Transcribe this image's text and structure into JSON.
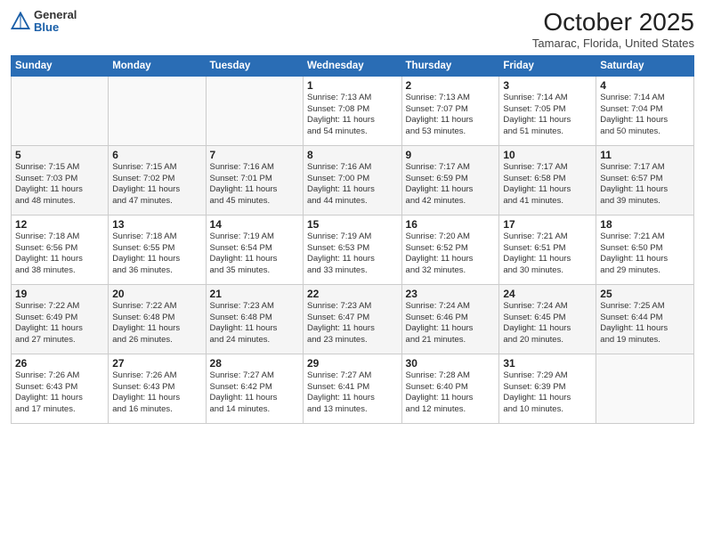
{
  "header": {
    "logo_general": "General",
    "logo_blue": "Blue",
    "month_title": "October 2025",
    "location": "Tamarac, Florida, United States"
  },
  "weekdays": [
    "Sunday",
    "Monday",
    "Tuesday",
    "Wednesday",
    "Thursday",
    "Friday",
    "Saturday"
  ],
  "weeks": [
    [
      {
        "day": "",
        "info": ""
      },
      {
        "day": "",
        "info": ""
      },
      {
        "day": "",
        "info": ""
      },
      {
        "day": "1",
        "info": "Sunrise: 7:13 AM\nSunset: 7:08 PM\nDaylight: 11 hours\nand 54 minutes."
      },
      {
        "day": "2",
        "info": "Sunrise: 7:13 AM\nSunset: 7:07 PM\nDaylight: 11 hours\nand 53 minutes."
      },
      {
        "day": "3",
        "info": "Sunrise: 7:14 AM\nSunset: 7:05 PM\nDaylight: 11 hours\nand 51 minutes."
      },
      {
        "day": "4",
        "info": "Sunrise: 7:14 AM\nSunset: 7:04 PM\nDaylight: 11 hours\nand 50 minutes."
      }
    ],
    [
      {
        "day": "5",
        "info": "Sunrise: 7:15 AM\nSunset: 7:03 PM\nDaylight: 11 hours\nand 48 minutes."
      },
      {
        "day": "6",
        "info": "Sunrise: 7:15 AM\nSunset: 7:02 PM\nDaylight: 11 hours\nand 47 minutes."
      },
      {
        "day": "7",
        "info": "Sunrise: 7:16 AM\nSunset: 7:01 PM\nDaylight: 11 hours\nand 45 minutes."
      },
      {
        "day": "8",
        "info": "Sunrise: 7:16 AM\nSunset: 7:00 PM\nDaylight: 11 hours\nand 44 minutes."
      },
      {
        "day": "9",
        "info": "Sunrise: 7:17 AM\nSunset: 6:59 PM\nDaylight: 11 hours\nand 42 minutes."
      },
      {
        "day": "10",
        "info": "Sunrise: 7:17 AM\nSunset: 6:58 PM\nDaylight: 11 hours\nand 41 minutes."
      },
      {
        "day": "11",
        "info": "Sunrise: 7:17 AM\nSunset: 6:57 PM\nDaylight: 11 hours\nand 39 minutes."
      }
    ],
    [
      {
        "day": "12",
        "info": "Sunrise: 7:18 AM\nSunset: 6:56 PM\nDaylight: 11 hours\nand 38 minutes."
      },
      {
        "day": "13",
        "info": "Sunrise: 7:18 AM\nSunset: 6:55 PM\nDaylight: 11 hours\nand 36 minutes."
      },
      {
        "day": "14",
        "info": "Sunrise: 7:19 AM\nSunset: 6:54 PM\nDaylight: 11 hours\nand 35 minutes."
      },
      {
        "day": "15",
        "info": "Sunrise: 7:19 AM\nSunset: 6:53 PM\nDaylight: 11 hours\nand 33 minutes."
      },
      {
        "day": "16",
        "info": "Sunrise: 7:20 AM\nSunset: 6:52 PM\nDaylight: 11 hours\nand 32 minutes."
      },
      {
        "day": "17",
        "info": "Sunrise: 7:21 AM\nSunset: 6:51 PM\nDaylight: 11 hours\nand 30 minutes."
      },
      {
        "day": "18",
        "info": "Sunrise: 7:21 AM\nSunset: 6:50 PM\nDaylight: 11 hours\nand 29 minutes."
      }
    ],
    [
      {
        "day": "19",
        "info": "Sunrise: 7:22 AM\nSunset: 6:49 PM\nDaylight: 11 hours\nand 27 minutes."
      },
      {
        "day": "20",
        "info": "Sunrise: 7:22 AM\nSunset: 6:48 PM\nDaylight: 11 hours\nand 26 minutes."
      },
      {
        "day": "21",
        "info": "Sunrise: 7:23 AM\nSunset: 6:48 PM\nDaylight: 11 hours\nand 24 minutes."
      },
      {
        "day": "22",
        "info": "Sunrise: 7:23 AM\nSunset: 6:47 PM\nDaylight: 11 hours\nand 23 minutes."
      },
      {
        "day": "23",
        "info": "Sunrise: 7:24 AM\nSunset: 6:46 PM\nDaylight: 11 hours\nand 21 minutes."
      },
      {
        "day": "24",
        "info": "Sunrise: 7:24 AM\nSunset: 6:45 PM\nDaylight: 11 hours\nand 20 minutes."
      },
      {
        "day": "25",
        "info": "Sunrise: 7:25 AM\nSunset: 6:44 PM\nDaylight: 11 hours\nand 19 minutes."
      }
    ],
    [
      {
        "day": "26",
        "info": "Sunrise: 7:26 AM\nSunset: 6:43 PM\nDaylight: 11 hours\nand 17 minutes."
      },
      {
        "day": "27",
        "info": "Sunrise: 7:26 AM\nSunset: 6:43 PM\nDaylight: 11 hours\nand 16 minutes."
      },
      {
        "day": "28",
        "info": "Sunrise: 7:27 AM\nSunset: 6:42 PM\nDaylight: 11 hours\nand 14 minutes."
      },
      {
        "day": "29",
        "info": "Sunrise: 7:27 AM\nSunset: 6:41 PM\nDaylight: 11 hours\nand 13 minutes."
      },
      {
        "day": "30",
        "info": "Sunrise: 7:28 AM\nSunset: 6:40 PM\nDaylight: 11 hours\nand 12 minutes."
      },
      {
        "day": "31",
        "info": "Sunrise: 7:29 AM\nSunset: 6:39 PM\nDaylight: 11 hours\nand 10 minutes."
      },
      {
        "day": "",
        "info": ""
      }
    ]
  ]
}
